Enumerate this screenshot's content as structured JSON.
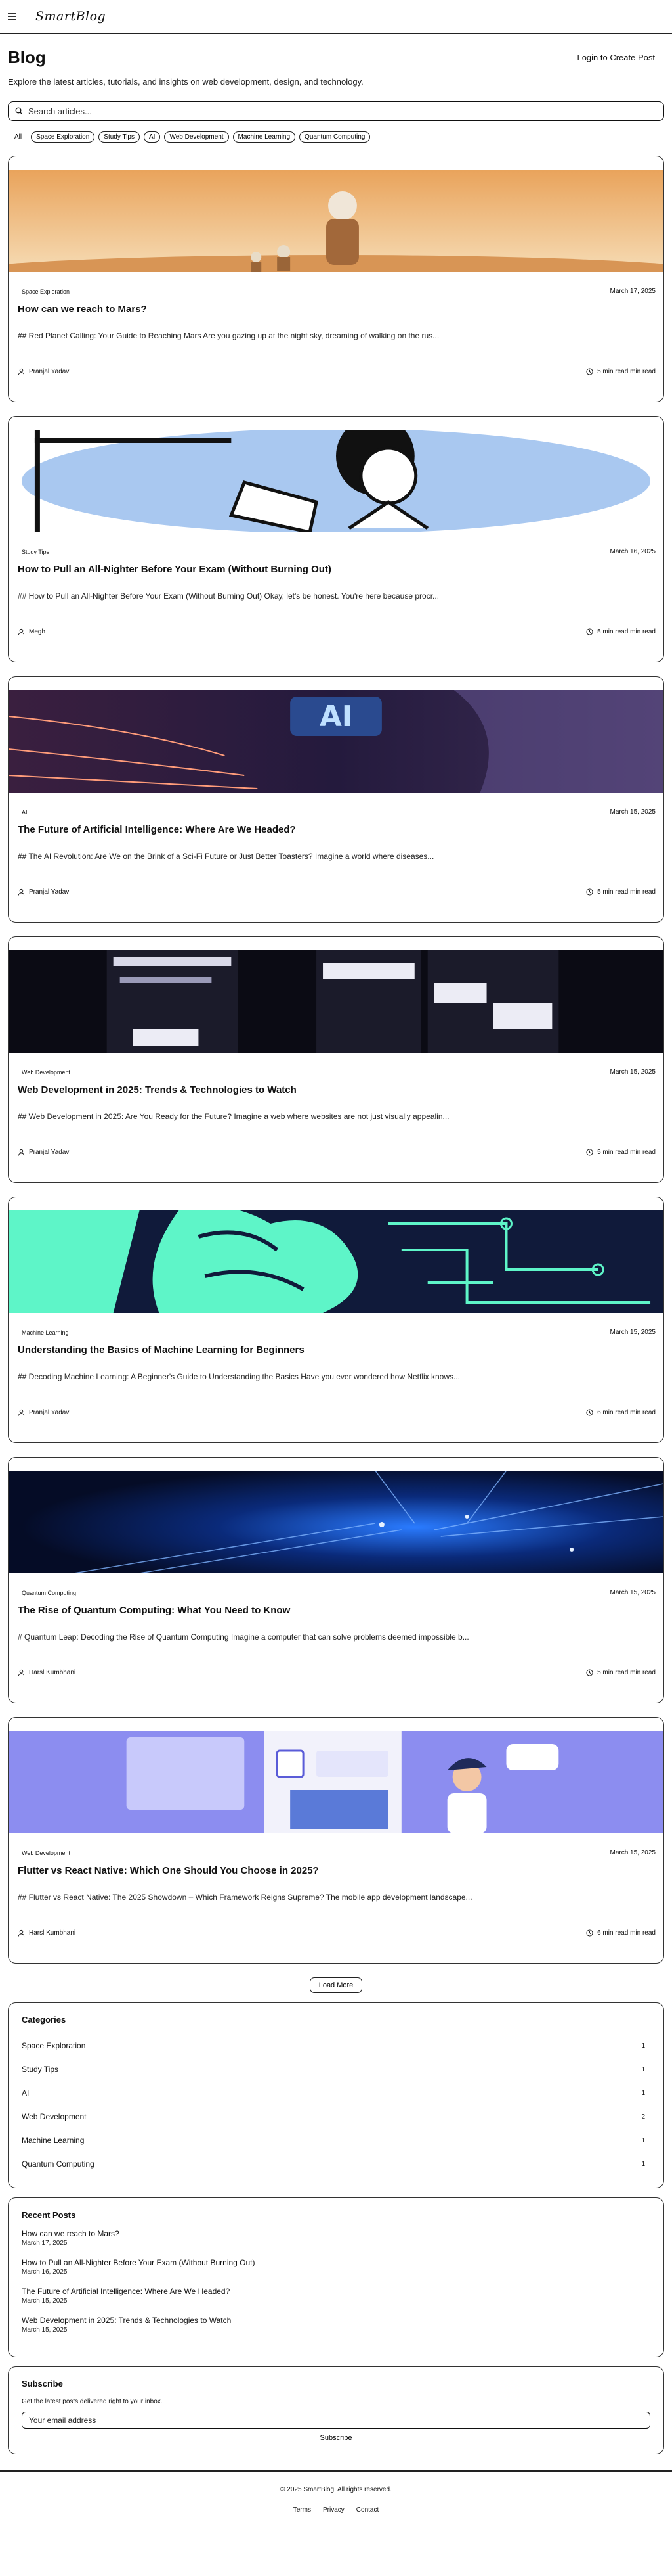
{
  "header": {
    "logo": "SmartBlog"
  },
  "page": {
    "title": "Blog",
    "login_link": "Login to Create Post",
    "description": "Explore the latest articles, tutorials, and insights on web development, design, and technology."
  },
  "search": {
    "placeholder": "Search articles..."
  },
  "filters": [
    "All",
    "Space Exploration",
    "Study Tips",
    "AI",
    "Web Development",
    "Machine Learning",
    "Quantum Computing"
  ],
  "posts": [
    {
      "category": "Space Exploration",
      "date": "March 17, 2025",
      "title": "How can we reach to Mars?",
      "excerpt": "## Red Planet Calling: Your Guide to Reaching Mars Are you gazing up at the night sky, dreaming of walking on the rus...",
      "author": "Pranjal Yadav",
      "read_time": "5 min read min read"
    },
    {
      "category": "Study Tips",
      "date": "March 16, 2025",
      "title": "How to Pull an All-Nighter Before Your Exam (Without Burning Out)",
      "excerpt": "## How to Pull an All-Nighter Before Your Exam (Without Burning Out) Okay, let's be honest. You're here because procr...",
      "author": "Megh",
      "read_time": "5 min read min read"
    },
    {
      "category": "AI",
      "date": "March 15, 2025",
      "title": "The Future of Artificial Intelligence: Where Are We Headed?",
      "excerpt": "## The AI Revolution: Are We on the Brink of a Sci-Fi Future or Just Better Toasters? Imagine a world where diseases...",
      "author": "Pranjal Yadav",
      "read_time": "5 min read min read"
    },
    {
      "category": "Web Development",
      "date": "March 15, 2025",
      "title": "Web Development in 2025: Trends & Technologies to Watch",
      "excerpt": "## Web Development in 2025: Are You Ready for the Future? Imagine a web where websites are not just visually appealin...",
      "author": "Pranjal Yadav",
      "read_time": "5 min read min read"
    },
    {
      "category": "Machine Learning",
      "date": "March 15, 2025",
      "title": "Understanding the Basics of Machine Learning for Beginners",
      "excerpt": "## Decoding Machine Learning: A Beginner's Guide to Understanding the Basics Have you ever wondered how Netflix knows...",
      "author": "Pranjal Yadav",
      "read_time": "6 min read min read"
    },
    {
      "category": "Quantum Computing",
      "date": "March 15, 2025",
      "title": "The Rise of Quantum Computing: What You Need to Know",
      "excerpt": "# Quantum Leap: Decoding the Rise of Quantum Computing Imagine a computer that can solve problems deemed impossible b...",
      "author": "Harsl Kumbhani",
      "read_time": "5 min read min read"
    },
    {
      "category": "Web Development",
      "date": "March 15, 2025",
      "title": "Flutter vs React Native: Which One Should You Choose in 2025?",
      "excerpt": "## Flutter vs React Native: The 2025 Showdown – Which Framework Reigns Supreme? The mobile app development landscape...",
      "author": "Harsl Kumbhani",
      "read_time": "6 min read min read"
    }
  ],
  "load_more": "Load More",
  "categories": {
    "title": "Categories",
    "items": [
      {
        "name": "Space Exploration",
        "count": "1"
      },
      {
        "name": "Study Tips",
        "count": "1"
      },
      {
        "name": "AI",
        "count": "1"
      },
      {
        "name": "Web Development",
        "count": "2"
      },
      {
        "name": "Machine Learning",
        "count": "1"
      },
      {
        "name": "Quantum Computing",
        "count": "1"
      }
    ]
  },
  "recent": {
    "title": "Recent Posts",
    "items": [
      {
        "title": "How can we reach to Mars?",
        "date": "March 17, 2025"
      },
      {
        "title": "How to Pull an All-Nighter Before Your Exam (Without Burning Out)",
        "date": "March 16, 2025"
      },
      {
        "title": "The Future of Artificial Intelligence: Where Are We Headed?",
        "date": "March 15, 2025"
      },
      {
        "title": "Web Development in 2025: Trends & Technologies to Watch",
        "date": "March 15, 2025"
      }
    ]
  },
  "subscribe": {
    "title": "Subscribe",
    "text": "Get the latest posts delivered right to your inbox.",
    "placeholder": "Your email address",
    "button": "Subscribe"
  },
  "footer": {
    "copyright": "© 2025 SmartBlog. All rights reserved.",
    "links": [
      "Terms",
      "Privacy",
      "Contact"
    ]
  }
}
